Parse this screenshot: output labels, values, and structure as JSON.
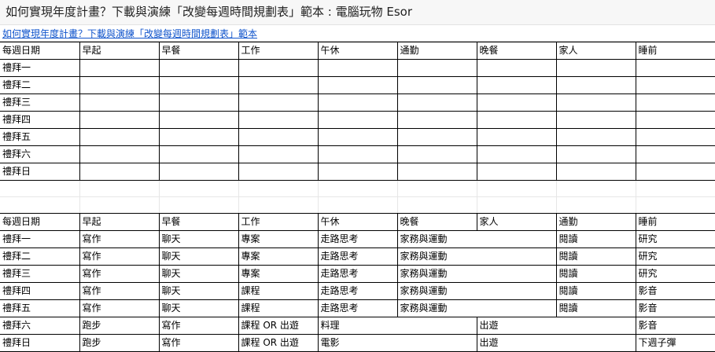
{
  "window": {
    "title": "如何實現年度計畫？下載與演練「改變每週時間規劃表」範本 : 電腦玩物 Esor"
  },
  "sheet": {
    "subtitle_link": "如何實現年度計畫？下載與演練「改變每週時間規劃表」範本"
  },
  "table1": {
    "headers": [
      "每週日期",
      "早起",
      "早餐",
      "工作",
      "午休",
      "通勤",
      "晚餐",
      "家人",
      "睡前"
    ],
    "rows": [
      [
        "禮拜一",
        "",
        "",
        "",
        "",
        "",
        "",
        "",
        ""
      ],
      [
        "禮拜二",
        "",
        "",
        "",
        "",
        "",
        "",
        "",
        ""
      ],
      [
        "禮拜三",
        "",
        "",
        "",
        "",
        "",
        "",
        "",
        ""
      ],
      [
        "禮拜四",
        "",
        "",
        "",
        "",
        "",
        "",
        "",
        ""
      ],
      [
        "禮拜五",
        "",
        "",
        "",
        "",
        "",
        "",
        "",
        ""
      ],
      [
        "禮拜六",
        "",
        "",
        "",
        "",
        "",
        "",
        "",
        ""
      ],
      [
        "禮拜日",
        "",
        "",
        "",
        "",
        "",
        "",
        "",
        ""
      ]
    ]
  },
  "table2": {
    "headers": [
      "每週日期",
      "早起",
      "早餐",
      "工作",
      "午休",
      "晚餐",
      "家人",
      "通勤",
      "睡前"
    ],
    "rows": [
      [
        "禮拜一",
        "寫作",
        "聊天",
        "專案",
        "走路思考",
        "家務與運動",
        "",
        "閱讀",
        "研究"
      ],
      [
        "禮拜二",
        "寫作",
        "聊天",
        "專案",
        "走路思考",
        "家務與運動",
        "",
        "閱讀",
        "研究"
      ],
      [
        "禮拜三",
        "寫作",
        "聊天",
        "專案",
        "走路思考",
        "家務與運動",
        "",
        "閱讀",
        "研究"
      ],
      [
        "禮拜四",
        "寫作",
        "聊天",
        "課程",
        "走路思考",
        "家務與運動",
        "",
        "閱讀",
        "影音"
      ],
      [
        "禮拜五",
        "寫作",
        "聊天",
        "課程",
        "走路思考",
        "家務與運動",
        "",
        "閱讀",
        "影音"
      ],
      [
        "禮拜六",
        "跑步",
        "寫作",
        "課程 OR 出遊",
        "料理",
        "",
        "出遊",
        "",
        "影音"
      ],
      [
        "禮拜日",
        "跑步",
        "寫作",
        "課程 OR 出遊",
        "電影",
        "",
        "出遊",
        "",
        "下週子彈"
      ]
    ]
  }
}
